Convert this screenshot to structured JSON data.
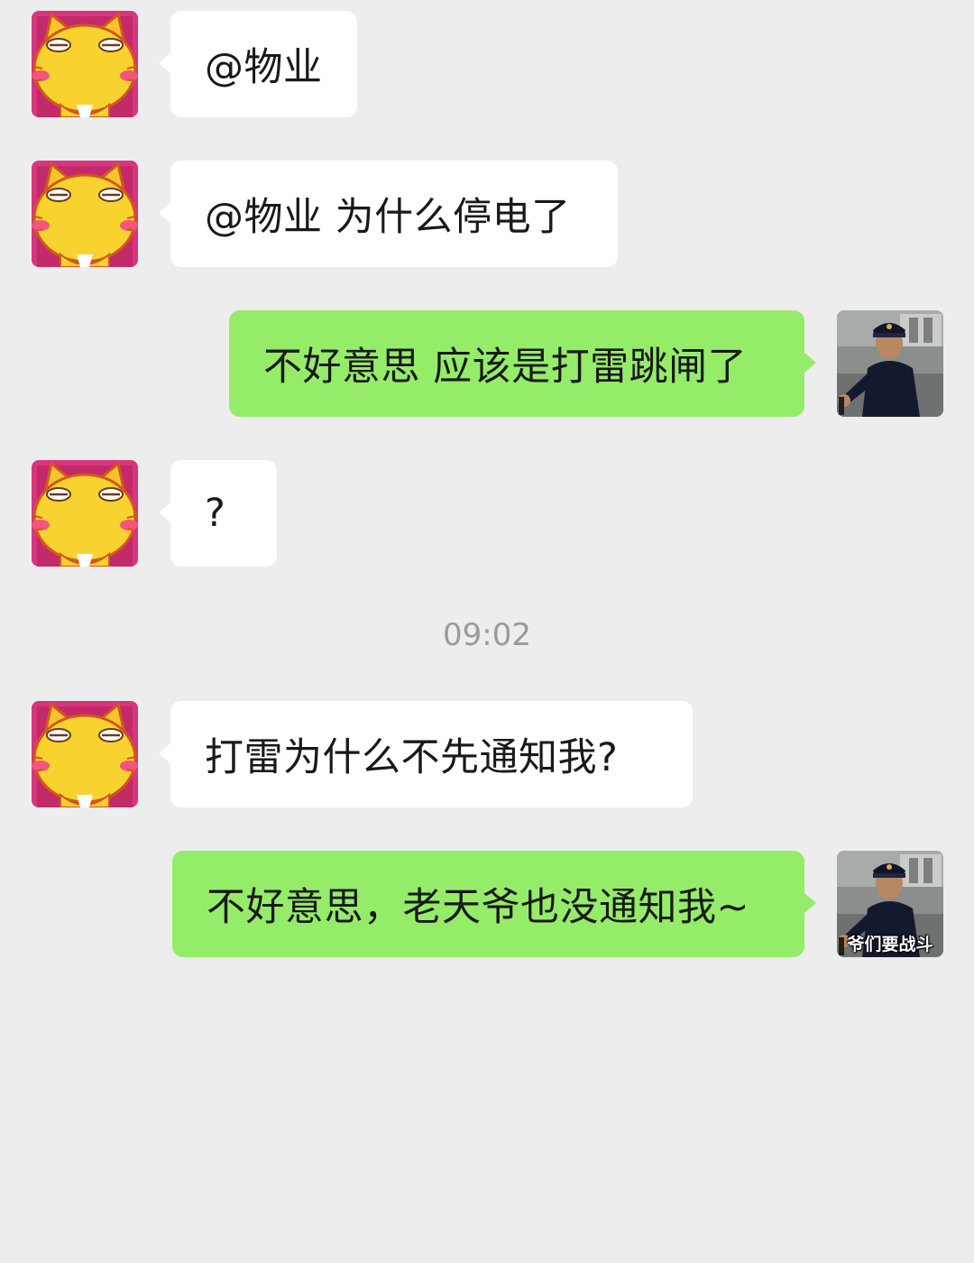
{
  "messages": [
    {
      "side": "in",
      "text": "@物业"
    },
    {
      "side": "in",
      "text": "@物业 为什么停电了"
    },
    {
      "side": "out",
      "text": "不好意思 应该是打雷跳闸了"
    },
    {
      "side": "in",
      "text": "?"
    },
    {
      "side": "in",
      "text": "打雷为什么不先通知我?"
    },
    {
      "side": "out",
      "text": "不好意思，老天爷也没通知我~",
      "avatar_caption": "爷们要战斗"
    }
  ],
  "timestamp": "09:02",
  "colors": {
    "background": "#ededed",
    "incoming_bubble": "#ffffff",
    "outgoing_bubble": "#95ec69",
    "timestamp_text": "#9a9a9a"
  },
  "icons": {
    "incoming_avatar": "yellow-cat-avatar",
    "outgoing_avatar": "officer-photo-avatar"
  }
}
